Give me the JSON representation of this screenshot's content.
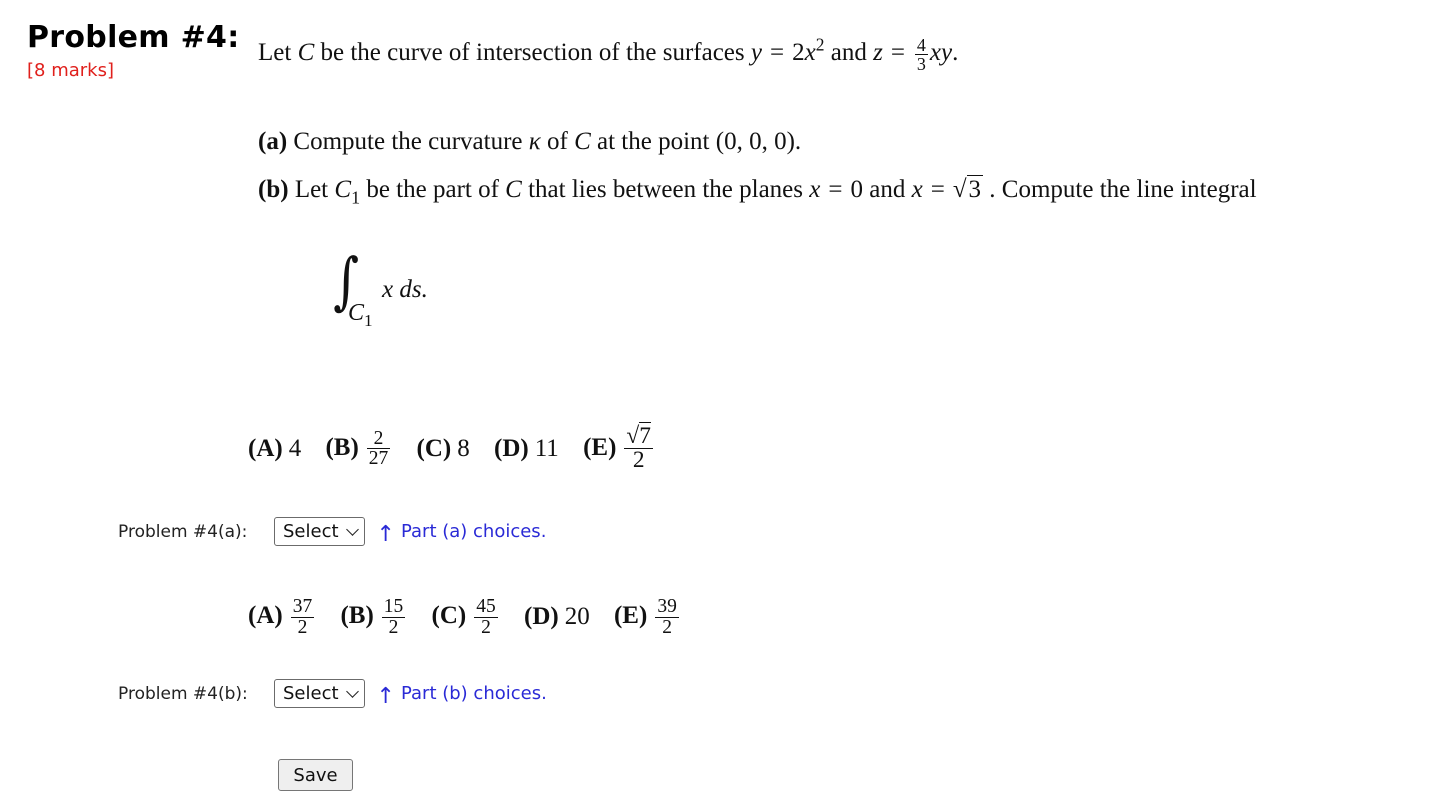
{
  "problem": {
    "title": "Problem #4:",
    "marks": "[8 marks]",
    "statement": {
      "t1": "Let ",
      "C": "C",
      "t2": " be the curve of intersection of the surfaces ",
      "y": "y",
      "eq": "=",
      "two": "2",
      "x": "x",
      "exp2": "2",
      "and": " and ",
      "z": "z",
      "frac_num": "4",
      "frac_den": "3",
      "xy": "xy",
      "period": "."
    },
    "part_a": {
      "label": "(a)",
      "t1": " Compute the curvature ",
      "kappa": "κ",
      "t2": " of ",
      "C": "C",
      "t3": " at the point (0, 0, 0)."
    },
    "part_b": {
      "label": "(b)",
      "t1": " Let ",
      "C": "C",
      "sub1": "1",
      "t2": " be the part of ",
      "t3": " that lies between the planes ",
      "x": "x",
      "eq": "=",
      "zero": "0",
      "and": " and ",
      "sqrt_arg": "3",
      "t4": " . Compute the line integral"
    },
    "integral": {
      "sign": "∫",
      "sub_C": "C",
      "sub_1": "1",
      "integrand": "x ds."
    }
  },
  "choices_a": [
    {
      "label": "(A)",
      "value": "4"
    },
    {
      "label": "(B)",
      "num": "2",
      "den": "27"
    },
    {
      "label": "(C)",
      "value": "8"
    },
    {
      "label": "(D)",
      "value": "11"
    },
    {
      "label": "(E)",
      "sqrt_num": "7",
      "den": "2"
    }
  ],
  "choices_b": [
    {
      "label": "(A)",
      "num": "37",
      "den": "2"
    },
    {
      "label": "(B)",
      "num": "15",
      "den": "2"
    },
    {
      "label": "(C)",
      "num": "45",
      "den": "2"
    },
    {
      "label": "(D)",
      "value": "20"
    },
    {
      "label": "(E)",
      "num": "39",
      "den": "2"
    }
  ],
  "answer_a": {
    "label": "Problem #4(a):",
    "select_value": "Select",
    "hint_icon": "up-arrow-icon",
    "hint_arrow": "↑",
    "hint": "Part (a) choices."
  },
  "answer_b": {
    "label": "Problem #4(b):",
    "select_value": "Select",
    "hint_icon": "up-arrow-icon",
    "hint_arrow": "↑",
    "hint": "Part (b) choices."
  },
  "save_label": "Save",
  "colors": {
    "marks": "#e0201c",
    "hint": "#2a2ad6"
  }
}
